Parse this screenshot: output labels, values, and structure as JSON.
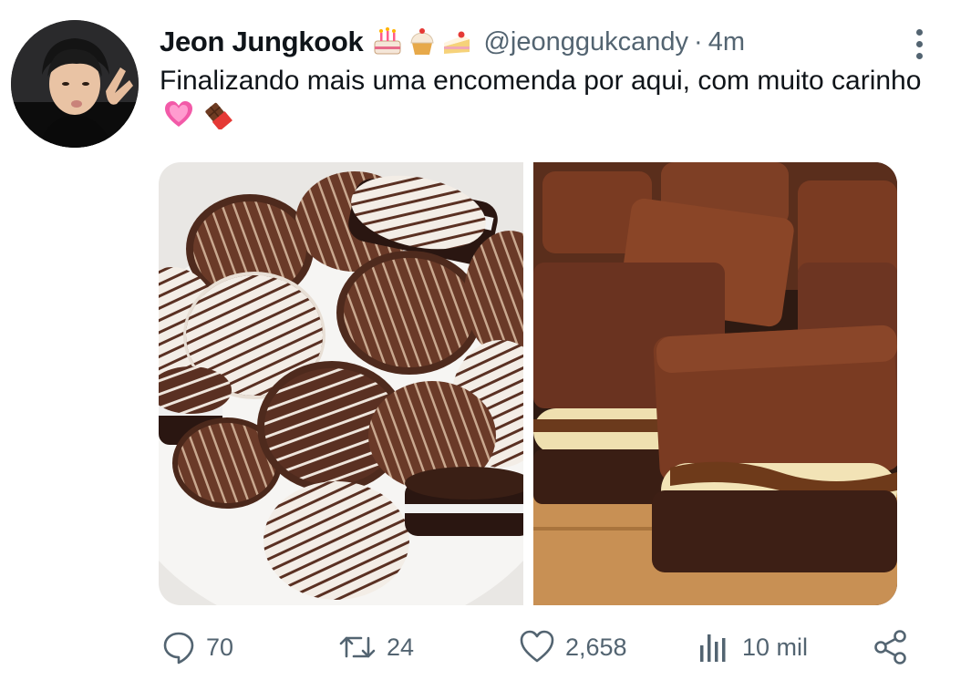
{
  "tweet": {
    "display_name": "Jeon Jungkook",
    "name_emojis": [
      "birthday-cake-icon",
      "cupcake-icon",
      "shortcake-icon"
    ],
    "handle": "@jeonggukcandy",
    "separator": "·",
    "time": "4m",
    "text_main": "Finalizando mais uma encomenda por aqui, com muito carinho",
    "text_emojis": [
      "sparkling-heart-icon",
      "chocolate-bar-icon"
    ],
    "media": [
      {
        "subject": "chocolate-covered-cookies-photo"
      },
      {
        "subject": "stuffed-brownies-photo"
      }
    ]
  },
  "actions": {
    "reply_count": "70",
    "retweet_count": "24",
    "like_count": "2,658",
    "views_count": "10 mil"
  },
  "colors": {
    "text": "#0f1419",
    "secondary": "#536471",
    "background": "#ffffff"
  }
}
